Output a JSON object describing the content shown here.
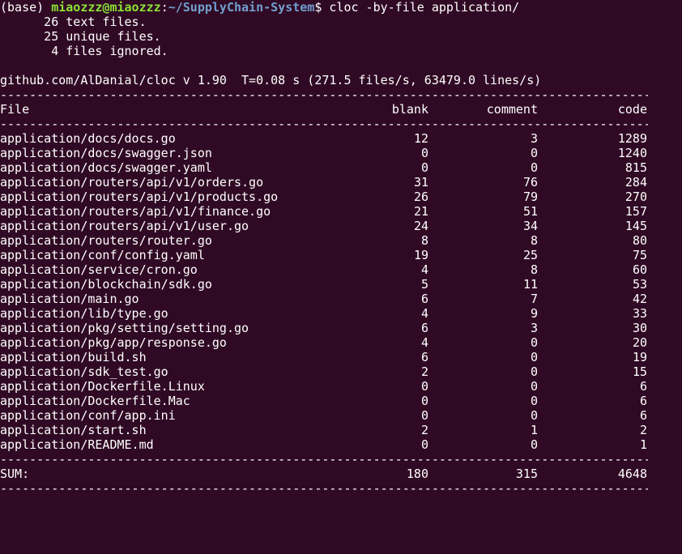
{
  "prompt": {
    "env": "(base)",
    "userhost": "miaozzz@miaozzz",
    "colon": ":",
    "path": "~/SupplyChain-System",
    "dollar": "$",
    "command": "cloc -by-file application/"
  },
  "summary": {
    "text_files": "      26 text files.",
    "unique_files": "      25 unique files.",
    "ignored_files": "       4 files ignored."
  },
  "version_line": "github.com/AlDanial/cloc v 1.90  T=0.08 s (271.5 files/s, 63479.0 lines/s)",
  "separator": "--------------------------------------------------------------------------------------------------------",
  "header": {
    "file": "File",
    "blank": "blank",
    "comment": "comment",
    "code": "code"
  },
  "rows": [
    {
      "file": "application/docs/docs.go",
      "blank": "12",
      "comment": "3",
      "code": "1289"
    },
    {
      "file": "application/docs/swagger.json",
      "blank": "0",
      "comment": "0",
      "code": "1240"
    },
    {
      "file": "application/docs/swagger.yaml",
      "blank": "0",
      "comment": "0",
      "code": "815"
    },
    {
      "file": "application/routers/api/v1/orders.go",
      "blank": "31",
      "comment": "76",
      "code": "284"
    },
    {
      "file": "application/routers/api/v1/products.go",
      "blank": "26",
      "comment": "79",
      "code": "270"
    },
    {
      "file": "application/routers/api/v1/finance.go",
      "blank": "21",
      "comment": "51",
      "code": "157"
    },
    {
      "file": "application/routers/api/v1/user.go",
      "blank": "24",
      "comment": "34",
      "code": "145"
    },
    {
      "file": "application/routers/router.go",
      "blank": "8",
      "comment": "8",
      "code": "80"
    },
    {
      "file": "application/conf/config.yaml",
      "blank": "19",
      "comment": "25",
      "code": "75"
    },
    {
      "file": "application/service/cron.go",
      "blank": "4",
      "comment": "8",
      "code": "60"
    },
    {
      "file": "application/blockchain/sdk.go",
      "blank": "5",
      "comment": "11",
      "code": "53"
    },
    {
      "file": "application/main.go",
      "blank": "6",
      "comment": "7",
      "code": "42"
    },
    {
      "file": "application/lib/type.go",
      "blank": "4",
      "comment": "9",
      "code": "33"
    },
    {
      "file": "application/pkg/setting/setting.go",
      "blank": "6",
      "comment": "3",
      "code": "30"
    },
    {
      "file": "application/pkg/app/response.go",
      "blank": "4",
      "comment": "0",
      "code": "20"
    },
    {
      "file": "application/build.sh",
      "blank": "6",
      "comment": "0",
      "code": "19"
    },
    {
      "file": "application/sdk_test.go",
      "blank": "2",
      "comment": "0",
      "code": "15"
    },
    {
      "file": "application/Dockerfile.Linux",
      "blank": "0",
      "comment": "0",
      "code": "6"
    },
    {
      "file": "application/Dockerfile.Mac",
      "blank": "0",
      "comment": "0",
      "code": "6"
    },
    {
      "file": "application/conf/app.ini",
      "blank": "0",
      "comment": "0",
      "code": "6"
    },
    {
      "file": "application/start.sh",
      "blank": "2",
      "comment": "1",
      "code": "2"
    },
    {
      "file": "application/README.md",
      "blank": "0",
      "comment": "0",
      "code": "1"
    }
  ],
  "sum": {
    "label": "SUM:",
    "blank": "180",
    "comment": "315",
    "code": "4648"
  },
  "colors": {
    "background": "#300a24",
    "text": "#ffffff",
    "userhost": "#8ae234",
    "path": "#729fcf"
  }
}
